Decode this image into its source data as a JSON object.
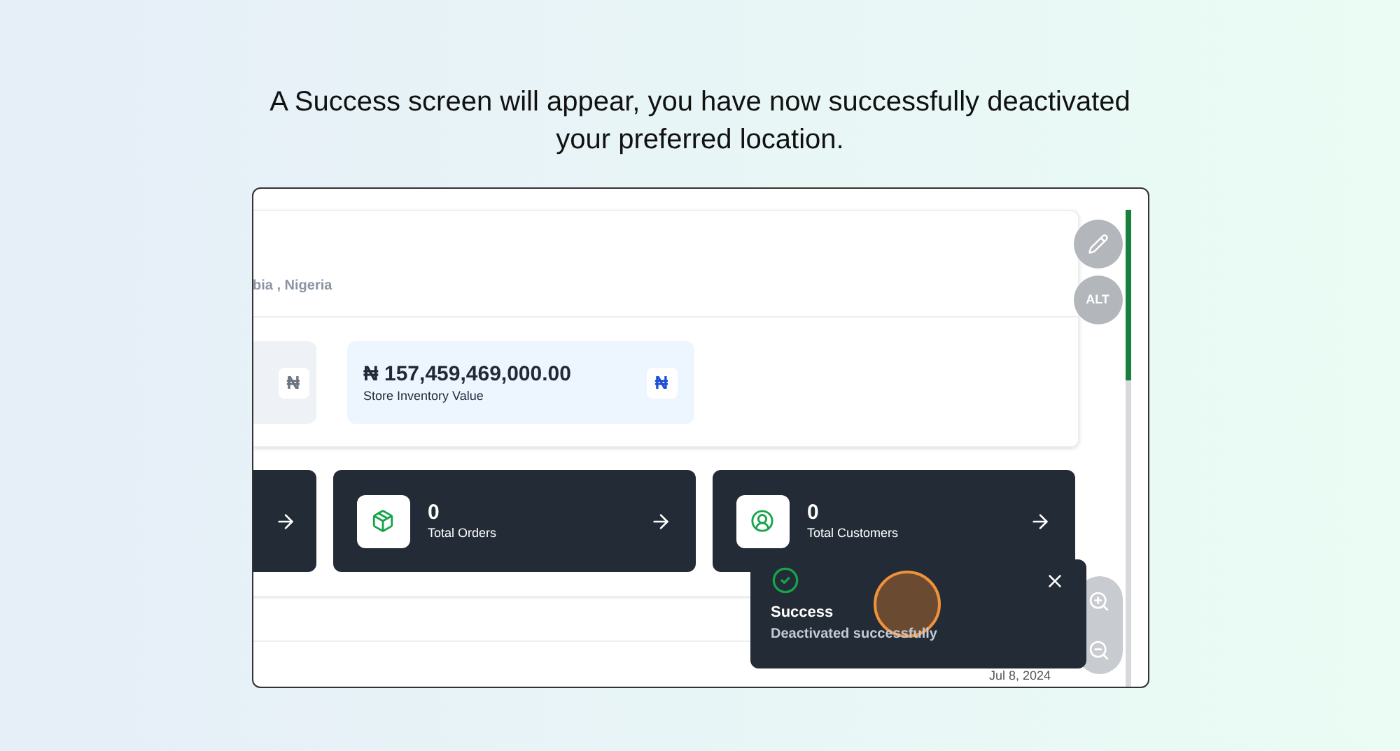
{
  "heading": "A Success screen will appear, you have now successfully deactivated your preferred location.",
  "store": {
    "location": "bia , Nigeria"
  },
  "value_cards": [
    {
      "kind": "partial",
      "icon": "₦"
    },
    {
      "kind": "full",
      "value": "₦ 157,459,469,000.00",
      "label": "Store Inventory Value",
      "icon": "₦"
    }
  ],
  "stat_cards": [
    {
      "kind": "partial"
    },
    {
      "kind": "orders",
      "count": "0",
      "label": "Total Orders"
    },
    {
      "kind": "customers",
      "count": "0",
      "label": "Total Customers"
    }
  ],
  "float_buttons": {
    "alt": "ALT"
  },
  "table": {
    "date": "Jul 8, 2024"
  },
  "toast": {
    "title": "Success",
    "message": "Deactivated successfully"
  }
}
